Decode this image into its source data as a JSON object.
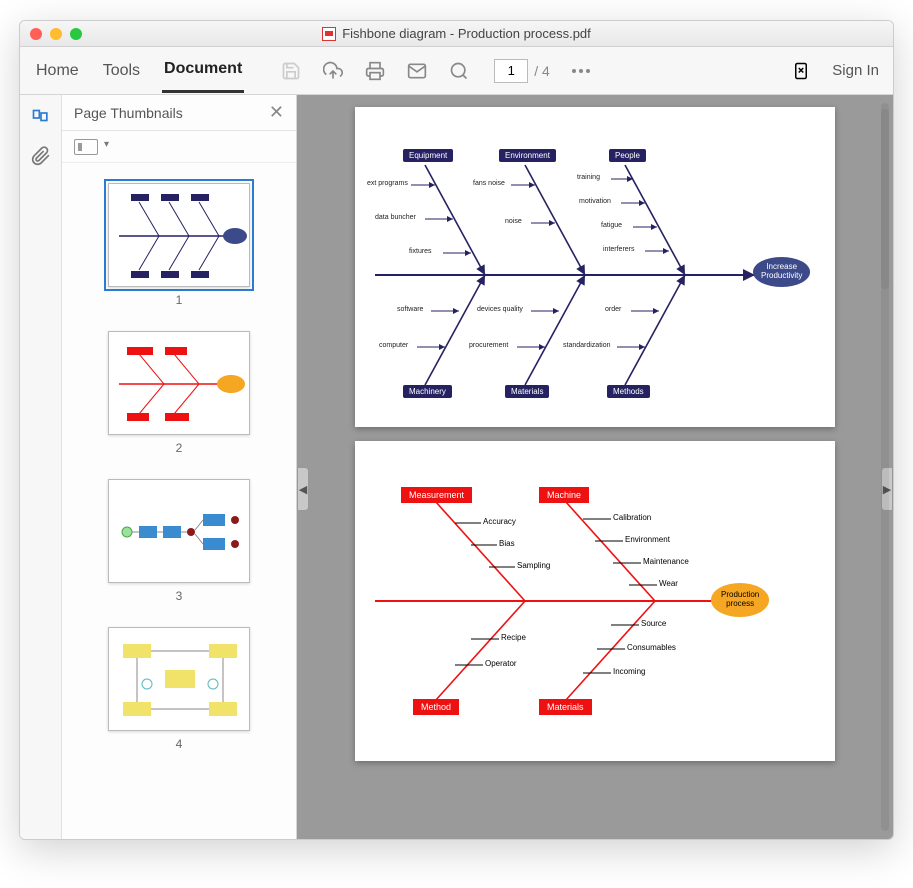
{
  "window": {
    "title": "Fishbone diagram - Production process.pdf"
  },
  "nav": {
    "home": "Home",
    "tools": "Tools",
    "document": "Document"
  },
  "toolbar": {
    "page_current": "1",
    "page_total": "/ 4",
    "signin": "Sign In"
  },
  "panel": {
    "title": "Page Thumbnails"
  },
  "thumbs": {
    "n1": "1",
    "n2": "2",
    "n3": "3",
    "n4": "4"
  },
  "fishbone1": {
    "categories_top": {
      "c1": "Equipment",
      "c2": "Environment",
      "c3": "People"
    },
    "categories_bottom": {
      "c1": "Machinery",
      "c2": "Materials",
      "c3": "Methods"
    },
    "causes": {
      "equipment": {
        "a": "ext programs",
        "b": "data buncher",
        "c": "fixtures"
      },
      "environment": {
        "a": "fans noise",
        "b": "noise"
      },
      "people": {
        "a": "training",
        "b": "motivation",
        "c": "fatigue",
        "d": "interferers"
      },
      "machinery": {
        "a": "software",
        "b": "computer"
      },
      "materials": {
        "a": "devices quality",
        "b": "procurement"
      },
      "methods": {
        "a": "order",
        "b": "standardization"
      }
    },
    "effect": "Increase\nProductivity"
  },
  "fishbone2": {
    "categories_top": {
      "c1": "Measurement",
      "c2": "Machine"
    },
    "categories_bottom": {
      "c1": "Method",
      "c2": "Materials"
    },
    "causes": {
      "measurement": {
        "a": "Accuracy",
        "b": "Bias",
        "c": "Sampling"
      },
      "machine": {
        "a": "Calibration",
        "b": "Environment",
        "c": "Maintenance",
        "d": "Wear"
      },
      "method": {
        "a": "Recipe",
        "b": "Operator"
      },
      "materials": {
        "a": "Source",
        "b": "Consumables",
        "c": "Incoming"
      }
    },
    "effect": "Production\nprocess"
  }
}
